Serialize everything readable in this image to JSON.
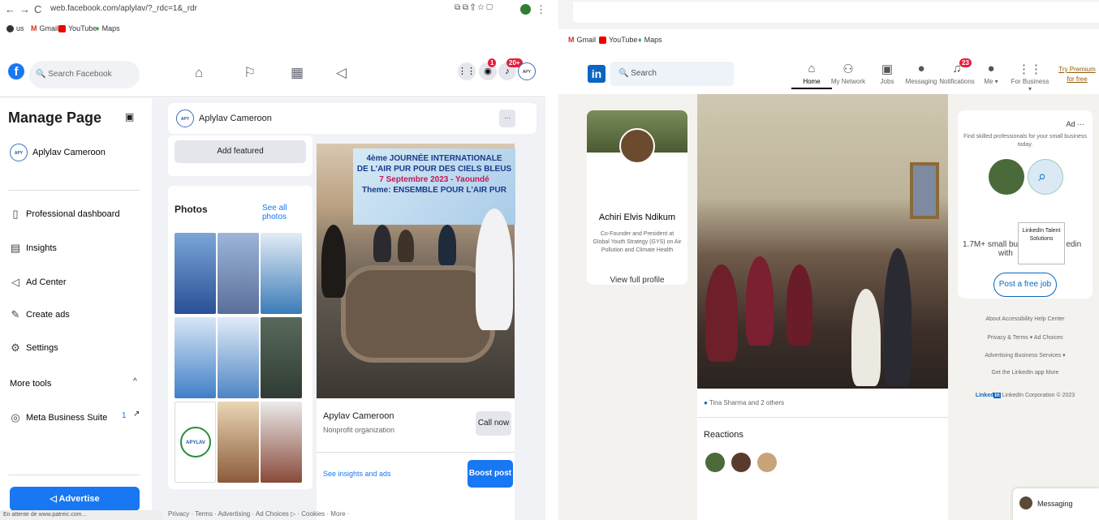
{
  "browser": {
    "url": "web.facebook.com/aplylav/?_rdc=1&_rdr",
    "bookmarks": [
      "us",
      "Gmail",
      "YouTube",
      "Maps"
    ],
    "status": "En attente de www.patreic.com..."
  },
  "facebook": {
    "search_placeholder": "Search Facebook",
    "notif_badge_1": "1",
    "notif_badge_2": "20+",
    "sidebar": {
      "title": "Manage Page",
      "page_name": "Aplylav Cameroon",
      "items": [
        "Professional dashboard",
        "Insights",
        "Ad Center",
        "Create ads",
        "Settings"
      ],
      "more_tools": "More tools",
      "meta": "Meta Business Suite",
      "meta_count": "1",
      "advertise": "Advertise"
    },
    "pagebar": {
      "name": "Aplylav Cameroon",
      "more": "···"
    },
    "add_featured": "Add featured",
    "photos": {
      "title": "Photos",
      "see_all": "See all photos"
    },
    "post": {
      "banner_line1": "4ème JOURNÉE INTERNATIONALE",
      "banner_line2": "DE L'AIR PUR POUR DES CIELS BLEUS",
      "banner_line3": "7 Septembre 2023 - Yaoundé",
      "banner_line4": "Theme: ENSEMBLE POUR L'AIR PUR",
      "org": "Apylav Cameroon",
      "org_type": "Nonprofit organization",
      "call": "Call now",
      "insights": "See insights and ads",
      "boost": "Boost post"
    },
    "footer": "Privacy · Terms · Advertising · Ad Choices ▷ · Cookies · More ·",
    "logo_text": "APYLAV"
  },
  "linkedin": {
    "bookmarks": [
      "Gmail",
      "YouTube",
      "Maps"
    ],
    "search_placeholder": "Search",
    "nav": [
      "Home",
      "My Network",
      "Jobs",
      "Messaging",
      "Notifications",
      "Me ▾",
      "For Business ▾"
    ],
    "notif_badge": "23",
    "premium": "Try Premium for free",
    "profile": {
      "name": "Achiri Elvis Ndikum",
      "desc": "Co-Founder and President at Global Youth Strategy (GYS) on Air Pollution and Climate Health",
      "view": "View full profile"
    },
    "feed": {
      "likes": "Tina Sharma and 2 others",
      "reactions": "Reactions"
    },
    "ad": {
      "label": "Ad ···",
      "text": "Find skilled professionals for your small business today.",
      "line": "1.7M+ small busi",
      "line2": "with",
      "line3": "edin",
      "tooltip": "LinkedIn Talent Solutions",
      "button": "Post a free job"
    },
    "footer": {
      "row1": "About   Accessibility   Help Center",
      "row2": "Privacy & Terms ▾   Ad Choices",
      "row3": "Advertising   Business Services ▾",
      "row4": "Get the LinkedIn app   More",
      "copyright": "LinkedIn Corporation © 2023",
      "brand": "Linked"
    },
    "messaging": "Messaging"
  }
}
